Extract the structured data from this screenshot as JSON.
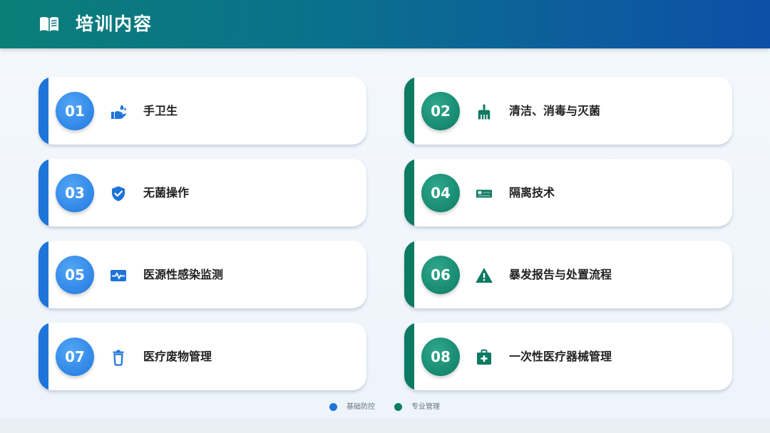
{
  "header": {
    "title": "培训内容",
    "icon": "book-open-icon"
  },
  "colors": {
    "blue": "#1e74d8",
    "green": "#0d7a63",
    "header_start": "#0a7f78",
    "header_end": "#0d4fa8"
  },
  "items": [
    {
      "num": "01",
      "label": "手卫生",
      "icon": "hand-wash-icon",
      "group": "blue"
    },
    {
      "num": "02",
      "label": "清洁、消毒与灭菌",
      "icon": "cleaning-brush-icon",
      "group": "green"
    },
    {
      "num": "03",
      "label": "无菌操作",
      "icon": "shield-check-icon",
      "group": "blue"
    },
    {
      "num": "04",
      "label": "隔离技术",
      "icon": "bed-icon",
      "group": "green"
    },
    {
      "num": "05",
      "label": "医源性感染监测",
      "icon": "monitor-pulse-icon",
      "group": "blue"
    },
    {
      "num": "06",
      "label": "暴发报告与处置流程",
      "icon": "warning-icon",
      "group": "green"
    },
    {
      "num": "07",
      "label": "医疗废物管理",
      "icon": "trash-icon",
      "group": "blue"
    },
    {
      "num": "08",
      "label": "一次性医疗器械管理",
      "icon": "medical-kit-icon",
      "group": "green"
    }
  ],
  "legend": [
    {
      "label": "基础防控",
      "color": "#1e74d8"
    },
    {
      "label": "专业管理",
      "color": "#0d7a63"
    }
  ]
}
